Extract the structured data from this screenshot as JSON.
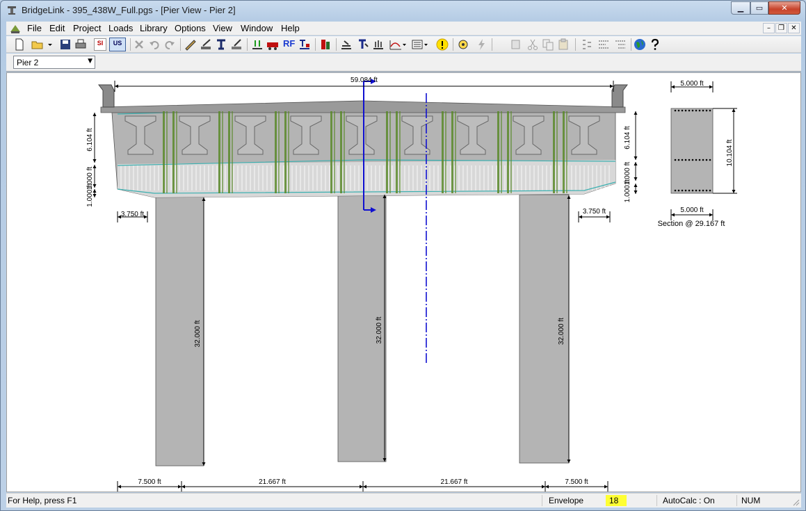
{
  "window": {
    "title": "BridgeLink - 395_438W_Full.pgs - [Pier View - Pier 2]",
    "buttons": {
      "minimize": "▁",
      "restore": "▭",
      "close": "✕"
    }
  },
  "menu": {
    "items": [
      "File",
      "Edit",
      "Project",
      "Loads",
      "Library",
      "Options",
      "View",
      "Window",
      "Help"
    ],
    "mdi_buttons": {
      "minimize": "–",
      "restore": "❐",
      "close": "✕"
    }
  },
  "toolbar": {
    "icons": [
      "new-file-icon",
      "open-folder-icon",
      "dropdown-arrow-icon",
      "save-icon",
      "print-icon",
      "si-units-icon",
      "us-units-icon",
      "delete-icon",
      "undo-icon",
      "redo-icon",
      "edit-bridge-icon",
      "edit-girder-icon",
      "edit-spans-icon",
      "edit-pier-icon",
      "edit-loads-icon",
      "live-load-icon",
      "rf-icon",
      "moment-diagram-icon",
      "concrete-icon",
      "analysis-results-icon",
      "influence-lines-icon",
      "stability-icon",
      "graph-icon",
      "report-icon",
      "status-warning-icon",
      "settings-icon",
      "lightning-icon",
      "copy-girder-icon",
      "cut-icon",
      "copy-icon",
      "paste-icon",
      "properties-icon",
      "align-icon",
      "tree-icon",
      "globe-icon",
      "help-icon"
    ],
    "si_label": "SI",
    "us_label": "US",
    "rf_label": "RF"
  },
  "pier_selector": {
    "value": "Pier 2"
  },
  "drawing": {
    "top_width": "59.084 ft",
    "left_height_top": "6.104 ft",
    "left_height_mid": "1.000 ft",
    "left_height_bot": "1.000 ft",
    "right_height_top": "6.104 ft",
    "right_height_mid": "1.000 ft",
    "right_height_bot": "1.000 ft",
    "left_overhang": "3.750 ft",
    "right_overhang": "3.750 ft",
    "column_heights": [
      "32.000 ft",
      "32.000 ft",
      "32.000 ft"
    ],
    "bottom_dims": [
      "7.500 ft",
      "21.667 ft",
      "21.667 ft",
      "7.500 ft"
    ],
    "section": {
      "top_width": "5.000 ft",
      "bottom_width": "5.000 ft",
      "height": "10.104 ft",
      "caption": "Section @ 29.167 ft"
    },
    "colors": {
      "concrete": "#b4b4b4",
      "cap_light": "#d8d8d8",
      "stirrup": "#5a8a2a",
      "teal": "#3bb0b0",
      "axis_blue": "#1010d0"
    }
  },
  "status": {
    "help": "For Help, press F1",
    "mode": "Envelope",
    "count": "18",
    "autocalc": "AutoCalc : On",
    "num": "NUM",
    "count_bg": "#ffff33"
  }
}
